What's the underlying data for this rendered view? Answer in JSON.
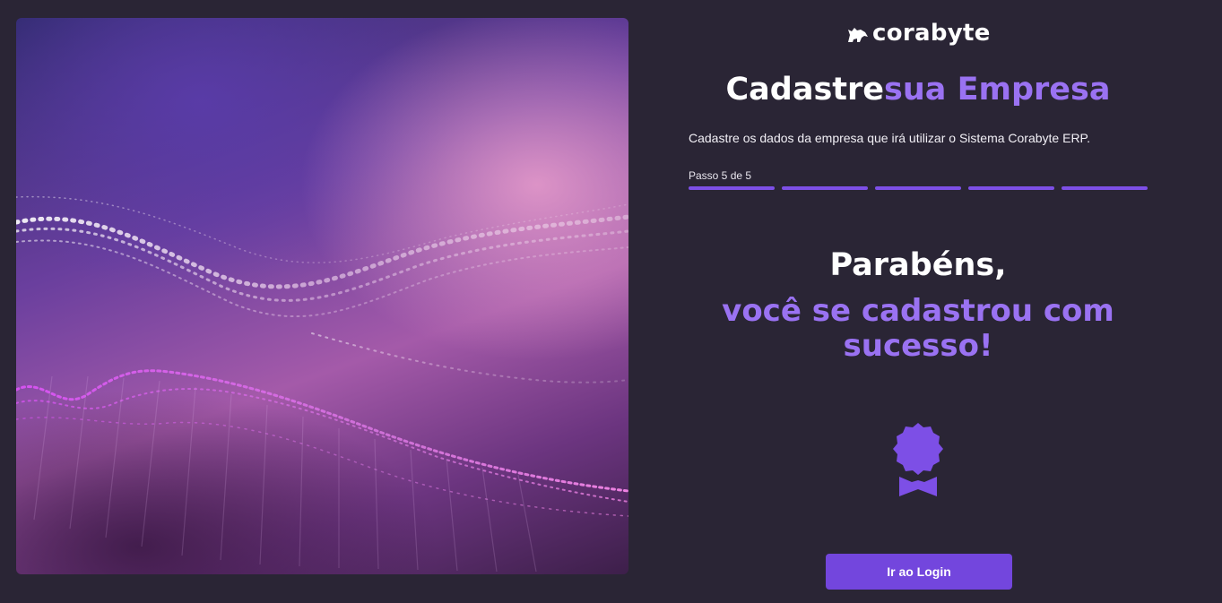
{
  "brand": {
    "name": "corabyte",
    "accent": "#9a72f2",
    "button_color": "#7346dd",
    "background": "#2a2535"
  },
  "header": {
    "title_part1": "Cadastre",
    "title_part2": "sua Empresa",
    "subtitle": "Cadastre os dados da empresa que irá utilizar o Sistema Corabyte ERP."
  },
  "progress": {
    "label": "Passo 5 de 5",
    "current_step": 5,
    "total_steps": 5
  },
  "result": {
    "headline": "Parabéns,",
    "message": "você se cadastrou com sucesso!",
    "icon": "award-badge-icon"
  },
  "actions": {
    "login_label": "Ir ao Login"
  }
}
